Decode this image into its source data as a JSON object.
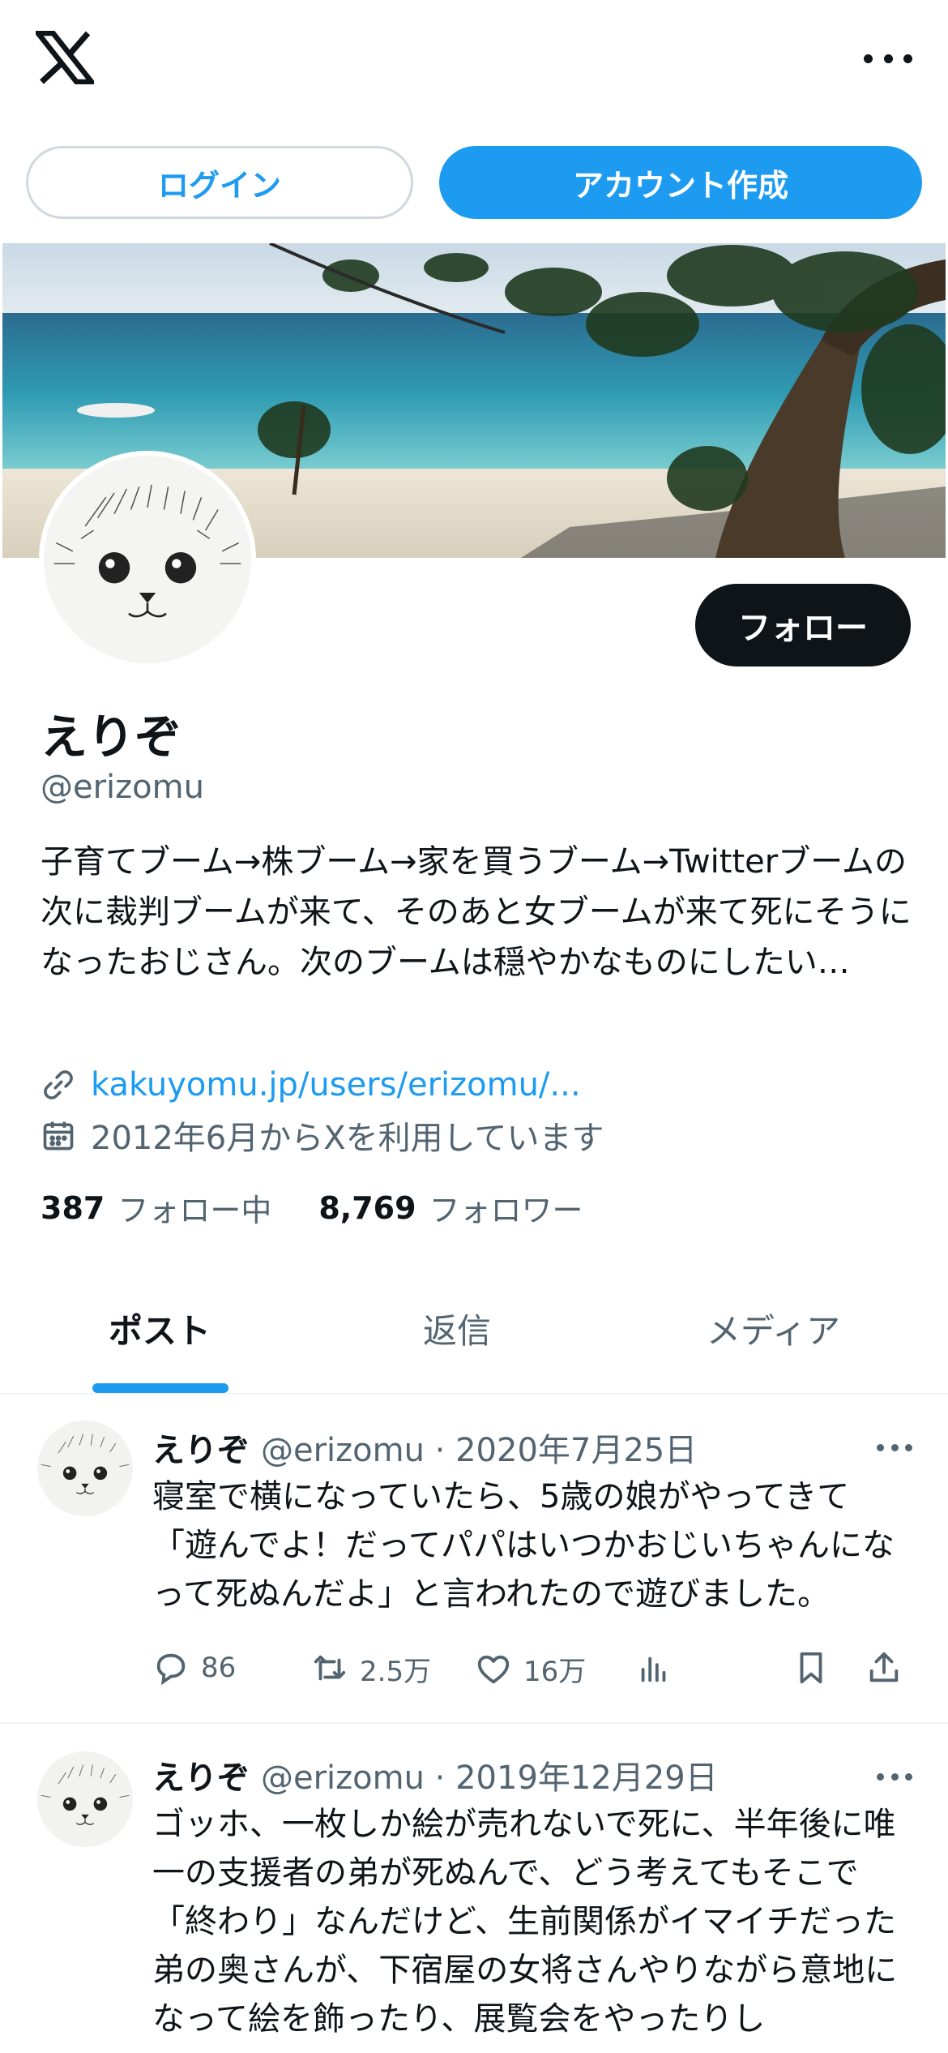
{
  "header": {
    "logo_icon": "x-logo-icon",
    "more_icon": "more-horizontal-icon"
  },
  "auth": {
    "login_label": "ログイン",
    "signup_label": "アカウント作成"
  },
  "profile": {
    "display_name": "えりぞ",
    "handle": "@erizomu",
    "bio": "子育てブーム→株ブーム→家を買うブーム→Twitterブームの次に裁判ブームが来て、そのあと女ブームが来て死にそうになったおじさん。次のブームは穏やかなものにしたい…",
    "link": "kakuyomu.jp/users/erizomu/...",
    "joined": "2012年6月からXを利用しています",
    "follow_label": "フォロー",
    "following_count": "387",
    "following_label": "フォロー中",
    "followers_count": "8,769",
    "followers_label": "フォロワー"
  },
  "tabs": [
    {
      "label": "ポスト",
      "active": true
    },
    {
      "label": "返信",
      "active": false
    },
    {
      "label": "メディア",
      "active": false
    }
  ],
  "posts": [
    {
      "name": "えりぞ",
      "handle": "@erizomu",
      "date": "2020年7月25日",
      "text": "寝室で横になっていたら、5歳の娘がやってきて「遊んでよ！だってパパはいつかおじいちゃんになって死ぬんだよ」と言われたので遊びました。",
      "replies": "86",
      "reposts": "2.5万",
      "likes": "16万"
    },
    {
      "name": "えりぞ",
      "handle": "@erizomu",
      "date": "2019年12月29日",
      "text": "ゴッホ、一枚しか絵が売れないで死に、半年後に唯一の支援者の弟が死ぬんで、どう考えてもそこで「終わり」なんだけど、生前関係がイマイチだった弟の奥さんが、下宿屋の女将さんやりながら意地になって絵を飾ったり、展覧会をやったりし"
    }
  ],
  "colors": {
    "accent": "#1d9bf0",
    "text": "#0f1419",
    "muted": "#536471",
    "divider": "#eff3f4"
  }
}
